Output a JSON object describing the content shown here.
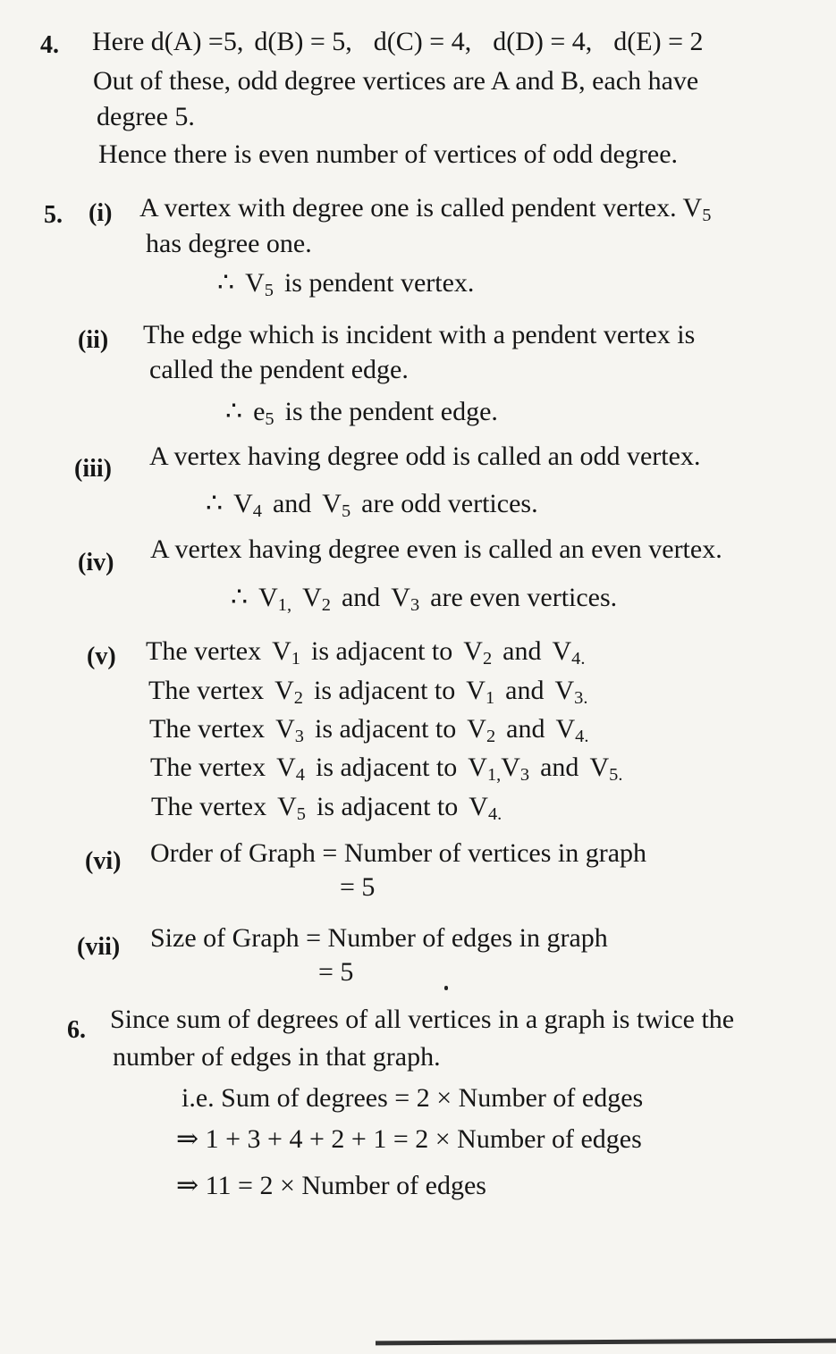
{
  "q4": {
    "number": "4.",
    "line1": {
      "pre": "Here d(A) =5,",
      "b": "d(B) = 5,",
      "c": "d(C) = 4,",
      "d": "d(D) = 4,",
      "e": "d(E) = 2"
    },
    "line2": "Out of these, odd degree vertices are A and B, each have",
    "line3": "degree 5.",
    "line4": "Hence there is even number of vertices of odd degree."
  },
  "q5": {
    "number": "5.",
    "i": {
      "label": "(i)",
      "line1": "A vertex with degree one is called pendent vertex. V",
      "line1_sub": "5",
      "line2": "has degree one.",
      "conclusion": {
        "therefore": "∴",
        "v": "V",
        "sub": "5",
        "text": "is pendent vertex."
      }
    },
    "ii": {
      "label": "(ii)",
      "line1": "The edge which is incident with a pendent vertex is",
      "line2": "called the pendent edge.",
      "conclusion": {
        "therefore": "∴",
        "e": "e",
        "sub": "5",
        "text": "is the pendent edge."
      }
    },
    "iii": {
      "label": "(iii)",
      "line1": "A vertex having degree odd is called an odd vertex.",
      "conclusion": {
        "therefore": "∴",
        "v1": "V",
        "s1": "4",
        "and": "and",
        "v2": "V",
        "s2": "5",
        "text": "are odd vertices."
      }
    },
    "iv": {
      "label": "(iv)",
      "line1": "A vertex having degree even is called an even vertex.",
      "conclusion": {
        "therefore": "∴",
        "v1": "V",
        "s1": "1,",
        "v2": "V",
        "s2": "2",
        "and": "and",
        "v3": "V",
        "s3": "3",
        "text": "are even vertices."
      }
    },
    "v": {
      "label": "(v)",
      "the_vertex": "The vertex",
      "v": "V",
      "adj": "is adjacent to",
      "and": "and",
      "rows": [
        {
          "s": "1",
          "a1": "2",
          "a2": "4",
          "end": "."
        },
        {
          "s": "2",
          "a1": "1",
          "a2": "3",
          "end": "."
        },
        {
          "s": "3",
          "a1": "2",
          "a2": "4",
          "end": "."
        },
        {
          "s": "4",
          "a1": "1,",
          "mid": "3",
          "a2": "5",
          "end": "."
        },
        {
          "s": "5",
          "a1": "4",
          "end": "."
        }
      ]
    },
    "vi": {
      "label": "(vi)",
      "line1": "Order of Graph = Number of vertices in graph",
      "line2": "= 5"
    },
    "vii": {
      "label": "(vii)",
      "line1": "Size of Graph = Number of edges in graph",
      "line2": "= 5"
    }
  },
  "q6": {
    "number": "6.",
    "line1": "Since sum of degrees of all vertices in a graph is twice the",
    "line2": "number of edges in that graph.",
    "line3": "i.e.  Sum of degrees = 2 × Number of edges",
    "line4": "⇒ 1 + 3 + 4 + 2 + 1 =  2 × Number of edges",
    "line5": "⇒ 11 = 2 × Number of edges"
  }
}
